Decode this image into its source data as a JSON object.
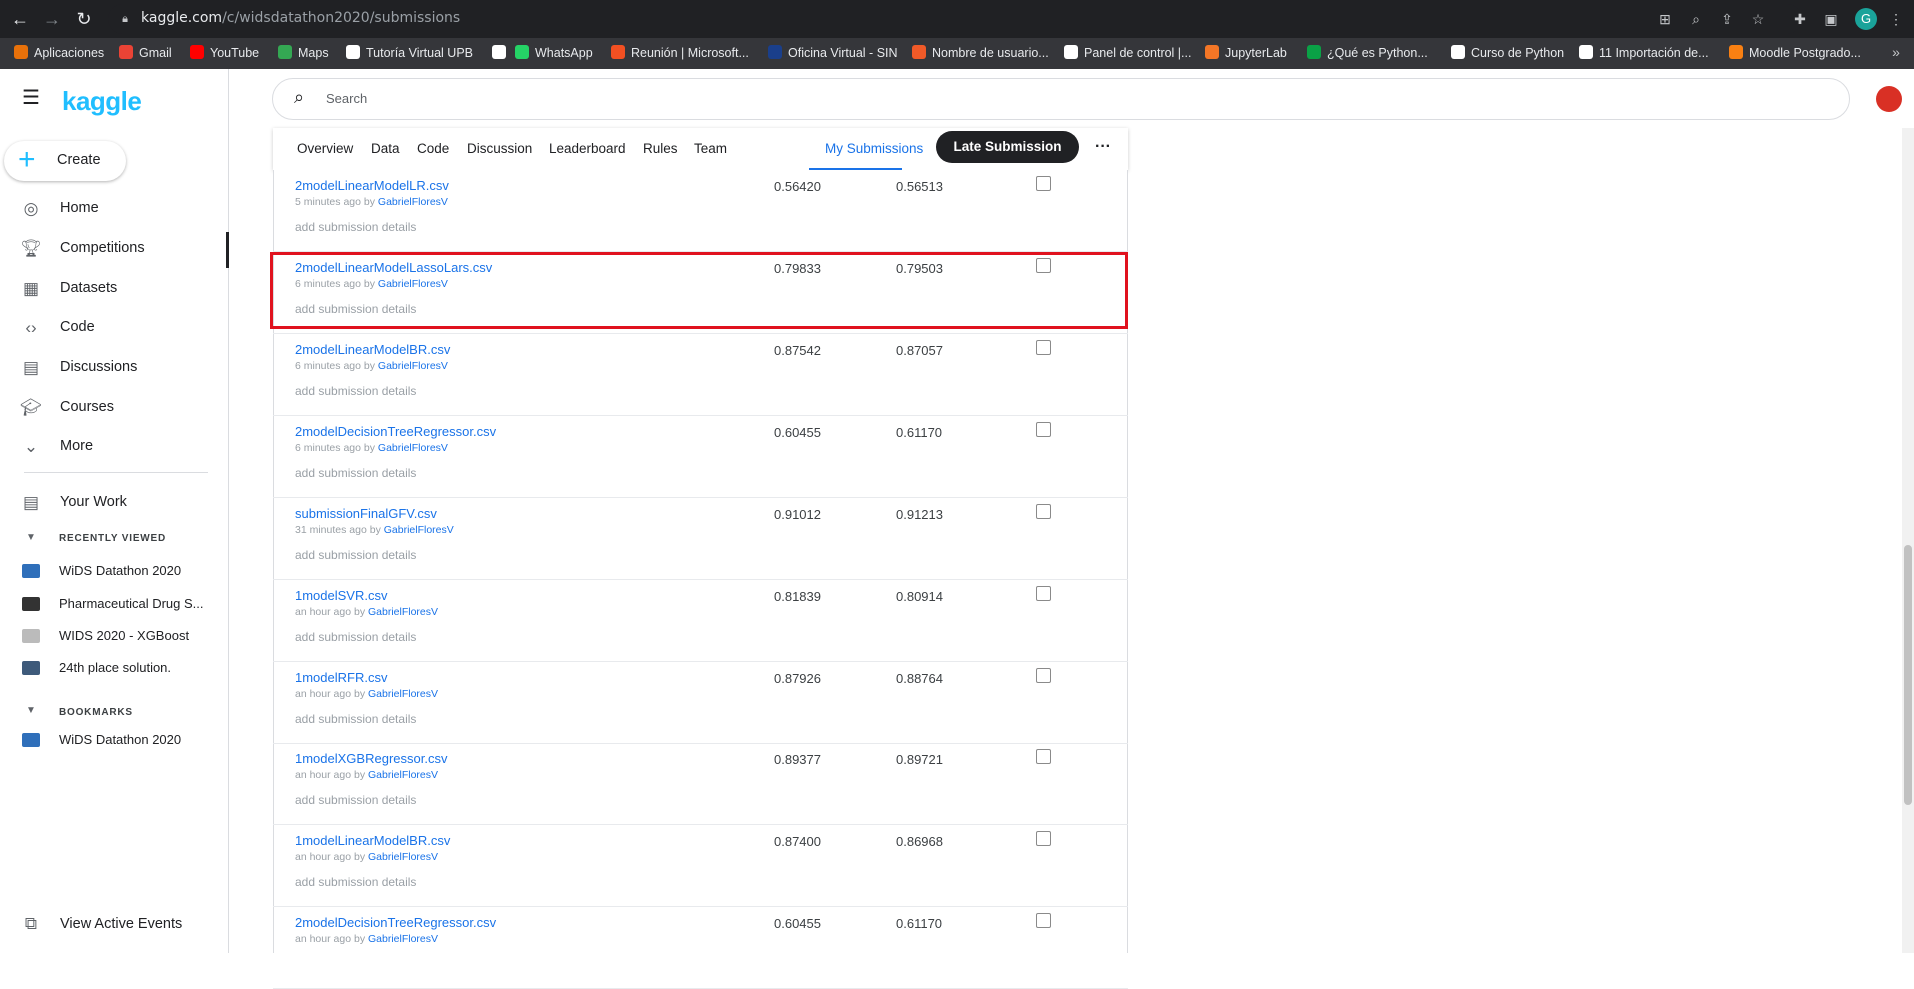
{
  "browser": {
    "url_host": "kaggle.com",
    "url_path": "/c/widsdatathon2020/submissions",
    "bookmarks": [
      {
        "label": "Aplicaciones",
        "color": "#e8710a"
      },
      {
        "label": "Gmail",
        "color": "#ea4335"
      },
      {
        "label": "YouTube",
        "color": "#ff0000"
      },
      {
        "label": "Maps",
        "color": "#34a853"
      },
      {
        "label": "Tutoría Virtual UPB",
        "color": "#ffffff"
      },
      {
        "label": "",
        "color": "#ffffff"
      },
      {
        "label": "WhatsApp",
        "color": "#25d366"
      },
      {
        "label": "Reunión | Microsoft...",
        "color": "#f25022"
      },
      {
        "label": "Oficina Virtual - SIN",
        "color": "#1a3f8b"
      },
      {
        "label": "Nombre de usuario...",
        "color": "#f05a28"
      },
      {
        "label": "Panel de control |...",
        "color": "#ffffff"
      },
      {
        "label": "JupyterLab",
        "color": "#f37626"
      },
      {
        "label": "¿Qué es Python...",
        "color": "#0aa146"
      },
      {
        "label": "Curso de Python",
        "color": "#ffffff"
      },
      {
        "label": "11 Importación de...",
        "color": "#ffffff"
      },
      {
        "label": "Moodle Postgrado...",
        "color": "#f98012"
      }
    ],
    "profile_initial": "G"
  },
  "sidebar": {
    "logo": "kaggle",
    "create_label": "Create",
    "items": [
      {
        "label": "Home",
        "icon": "compass-icon"
      },
      {
        "label": "Competitions",
        "icon": "trophy-icon"
      },
      {
        "label": "Datasets",
        "icon": "table-icon"
      },
      {
        "label": "Code",
        "icon": "code-icon"
      },
      {
        "label": "Discussions",
        "icon": "comments-icon"
      },
      {
        "label": "Courses",
        "icon": "school-icon"
      },
      {
        "label": "More",
        "icon": "chevron-down-icon"
      }
    ],
    "your_work": "Your Work",
    "recently_viewed_header": "RECENTLY VIEWED",
    "recent": [
      {
        "label": "WiDS Datathon 2020",
        "color": "#2f6fba"
      },
      {
        "label": "Pharmaceutical Drug S...",
        "color": "#333333"
      },
      {
        "label": "WIDS 2020 - XGBoost",
        "color": "#bbbbbb"
      },
      {
        "label": "24th place solution.",
        "color": "#3e5a7a"
      }
    ],
    "bookmarks_header": "BOOKMARKS",
    "bookmarks": [
      {
        "label": "WiDS Datathon 2020",
        "color": "#2f6fba"
      }
    ],
    "view_active_events": "View Active Events"
  },
  "search": {
    "placeholder": "Search"
  },
  "tabs": {
    "items": [
      "Overview",
      "Data",
      "Code",
      "Discussion",
      "Leaderboard",
      "Rules",
      "Team"
    ],
    "my_submissions": "My Submissions",
    "late_submission": "Late Submission",
    "more": "···"
  },
  "submissions": [
    {
      "file": "2modelLinearModelLR.csv",
      "time": "5 minutes ago",
      "by": "by",
      "user": "GabrielFloresV",
      "details": "add submission details",
      "private": "0.56420",
      "public": "0.56513"
    },
    {
      "file": "2modelLinearModelLassoLars.csv",
      "time": "6 minutes ago",
      "by": "by",
      "user": "GabrielFloresV",
      "details": "add submission details",
      "private": "0.79833",
      "public": "0.79503"
    },
    {
      "file": "2modelLinearModelBR.csv",
      "time": "6 minutes ago",
      "by": "by",
      "user": "GabrielFloresV",
      "details": "add submission details",
      "private": "0.87542",
      "public": "0.87057"
    },
    {
      "file": "2modelDecisionTreeRegressor.csv",
      "time": "6 minutes ago",
      "by": "by",
      "user": "GabrielFloresV",
      "details": "add submission details",
      "private": "0.60455",
      "public": "0.61170"
    },
    {
      "file": "submissionFinalGFV.csv",
      "time": "31 minutes ago",
      "by": "by",
      "user": "GabrielFloresV",
      "details": "add submission details",
      "private": "0.91012",
      "public": "0.91213"
    },
    {
      "file": "1modelSVR.csv",
      "time": "an hour ago",
      "by": "by",
      "user": "GabrielFloresV",
      "details": "add submission details",
      "private": "0.81839",
      "public": "0.80914"
    },
    {
      "file": "1modelRFR.csv",
      "time": "an hour ago",
      "by": "by",
      "user": "GabrielFloresV",
      "details": "add submission details",
      "private": "0.87926",
      "public": "0.88764"
    },
    {
      "file": "1modelXGBRegressor.csv",
      "time": "an hour ago",
      "by": "by",
      "user": "GabrielFloresV",
      "details": "add submission details",
      "private": "0.89377",
      "public": "0.89721"
    },
    {
      "file": "1modelLinearModelBR.csv",
      "time": "an hour ago",
      "by": "by",
      "user": "GabrielFloresV",
      "details": "add submission details",
      "private": "0.87400",
      "public": "0.86968"
    },
    {
      "file": "2modelDecisionTreeRegressor.csv",
      "time": "an hour ago",
      "by": "by",
      "user": "GabrielFloresV",
      "details": "",
      "private": "0.60455",
      "public": "0.61170"
    }
  ]
}
